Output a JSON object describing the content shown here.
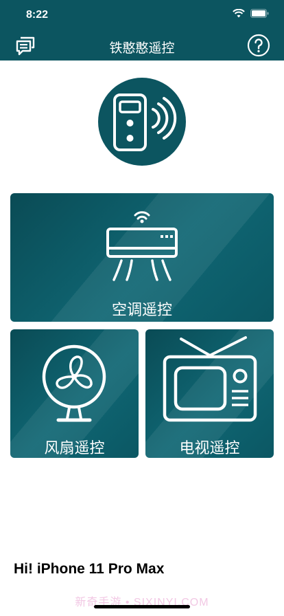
{
  "status_bar": {
    "time": "8:22"
  },
  "nav": {
    "title": "铁憨憨遥控",
    "left_icon": "feedback-chat-icon",
    "right_icon": "help-icon"
  },
  "hero": {
    "icon": "remote-control-icon"
  },
  "cards": {
    "ac": {
      "label": "空调遥控",
      "icon": "air-conditioner-icon"
    },
    "fan": {
      "label": "风扇遥控",
      "icon": "fan-icon"
    },
    "tv": {
      "label": "电视遥控",
      "icon": "tv-icon"
    }
  },
  "footer": {
    "device_text": "Hi!  iPhone 11 Pro Max"
  },
  "watermark": "新奇手游 • SIXINYI.COM",
  "colors": {
    "primary": "#0c5560",
    "card_dark": "#0a4b55",
    "card_light": "#0f6673"
  }
}
